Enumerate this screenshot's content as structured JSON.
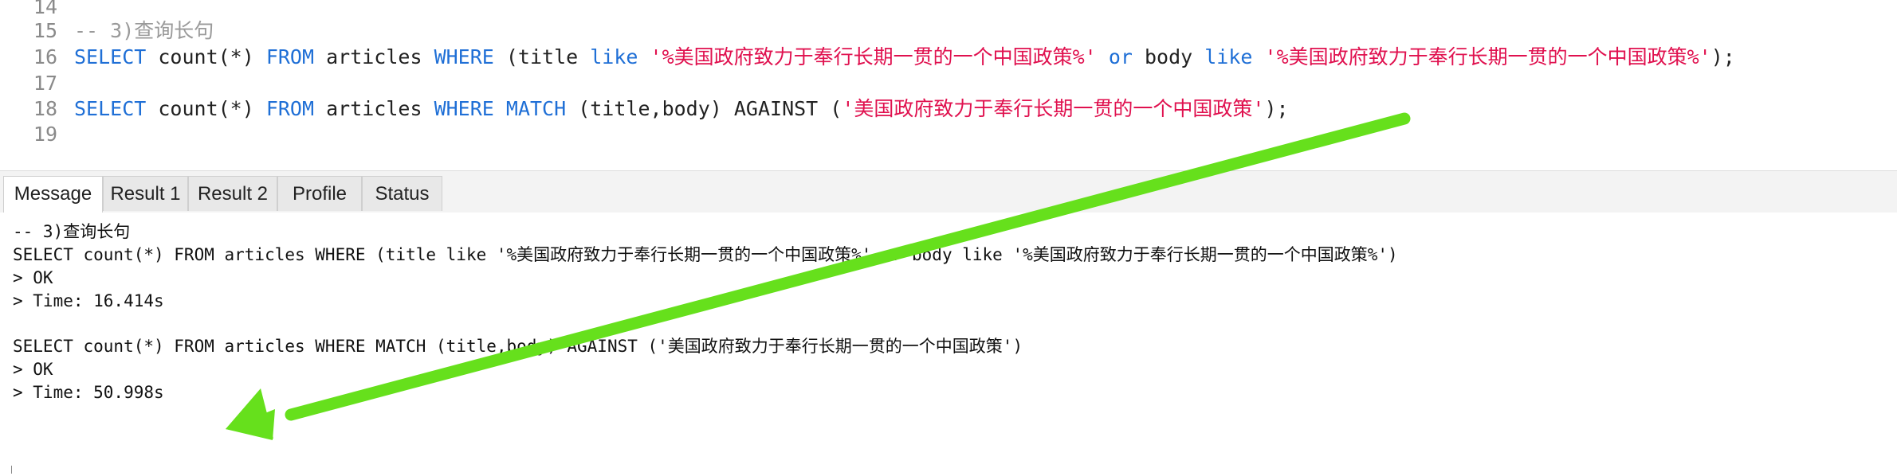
{
  "editor": {
    "lines": [
      {
        "number": "14",
        "segments": []
      },
      {
        "number": "15",
        "segments": [
          {
            "text": "-- 3)查询长句",
            "style": "cmt"
          }
        ]
      },
      {
        "number": "16",
        "segments": [
          {
            "text": "SELECT",
            "style": "kw"
          },
          {
            "text": " count(*) ",
            "style": "plain"
          },
          {
            "text": "FROM",
            "style": "kw"
          },
          {
            "text": " articles ",
            "style": "plain"
          },
          {
            "text": "WHERE",
            "style": "kw"
          },
          {
            "text": " (title ",
            "style": "plain"
          },
          {
            "text": "like",
            "style": "kw"
          },
          {
            "text": " ",
            "style": "plain"
          },
          {
            "text": "'%美国政府致力于奉行长期一贯的一个中国政策%'",
            "style": "str"
          },
          {
            "text": " ",
            "style": "plain"
          },
          {
            "text": "or",
            "style": "kw"
          },
          {
            "text": " body ",
            "style": "plain"
          },
          {
            "text": "like",
            "style": "kw"
          },
          {
            "text": " ",
            "style": "plain"
          },
          {
            "text": "'%美国政府致力于奉行长期一贯的一个中国政策%'",
            "style": "str"
          },
          {
            "text": ");",
            "style": "plain"
          }
        ]
      },
      {
        "number": "17",
        "segments": []
      },
      {
        "number": "18",
        "segments": [
          {
            "text": "SELECT",
            "style": "kw"
          },
          {
            "text": " count(*) ",
            "style": "plain"
          },
          {
            "text": "FROM",
            "style": "kw"
          },
          {
            "text": " articles ",
            "style": "plain"
          },
          {
            "text": "WHERE",
            "style": "kw"
          },
          {
            "text": " ",
            "style": "plain"
          },
          {
            "text": "MATCH",
            "style": "kw"
          },
          {
            "text": " (title,body) AGAINST (",
            "style": "plain"
          },
          {
            "text": "'美国政府致力于奉行长期一贯的一个中国政策'",
            "style": "str"
          },
          {
            "text": ");",
            "style": "plain"
          }
        ]
      },
      {
        "number": "19",
        "segments": []
      }
    ]
  },
  "tabs": [
    {
      "label": "Message",
      "active": true
    },
    {
      "label": "Result 1",
      "active": false
    },
    {
      "label": "Result 2",
      "active": false
    },
    {
      "label": "Profile",
      "active": false
    },
    {
      "label": "Status",
      "active": false
    }
  ],
  "messages": [
    "-- 3)查询长句",
    "SELECT count(*) FROM articles WHERE (title like '%美国政府致力于奉行长期一贯的一个中国政策%' or body like '%美国政府致力于奉行长期一贯的一个中国政策%')",
    "> OK",
    "> Time: 16.414s",
    "",
    "",
    "SELECT count(*) FROM articles WHERE MATCH (title,body) AGAINST ('美国政府致力于奉行长期一贯的一个中国政策')",
    "> OK",
    "> Time: 50.998s"
  ],
  "colors": {
    "keyword": "#1f6fd6",
    "string": "#e0114f",
    "comment": "#9a9a9a",
    "arrow": "#66e01c"
  },
  "annotation": {
    "type": "arrow",
    "icon": "green-arrow-icon"
  }
}
